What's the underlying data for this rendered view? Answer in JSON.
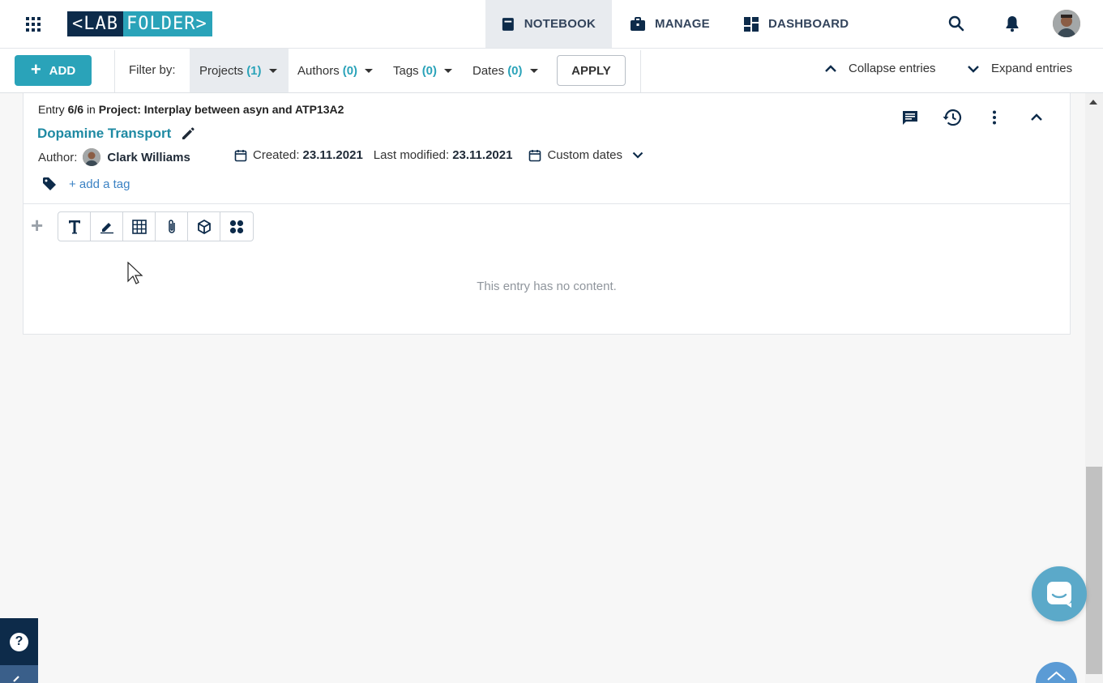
{
  "app": {
    "logo_left": "<LAB",
    "logo_right": "FOLDER>"
  },
  "nav": {
    "notebook": "NOTEBOOK",
    "manage": "MANAGE",
    "dashboard": "DASHBOARD"
  },
  "toolbar": {
    "add_label": "ADD",
    "filter_by": "Filter by:",
    "filters": {
      "projects": {
        "label": "Projects",
        "count": "(1)"
      },
      "authors": {
        "label": "Authors",
        "count": "(0)"
      },
      "tags": {
        "label": "Tags",
        "count": "(0)"
      },
      "dates": {
        "label": "Dates",
        "count": "(0)"
      }
    },
    "apply": "APPLY",
    "collapse": "Collapse entries",
    "expand": "Expand entries"
  },
  "entry": {
    "prefix": "Entry",
    "position": "6/6",
    "in": "in",
    "project": "Project: Interplay between asyn and ATP13A2",
    "title": "Dopamine Transport",
    "author_label": "Author:",
    "author_name": "Clark Williams",
    "created_label": "Created:",
    "created_date": "23.11.2021",
    "modified_label": "Last modified:",
    "modified_date": "23.11.2021",
    "custom_dates": "Custom dates",
    "add_tag": "+ add a tag",
    "empty_message": "This entry has no content."
  },
  "help": {
    "symbol": "?"
  },
  "colors": {
    "brand_dark": "#0d2b4a",
    "brand_teal": "#2aa3b9",
    "link_blue": "#3b82c4",
    "chat_blue": "#5ba9c9"
  }
}
